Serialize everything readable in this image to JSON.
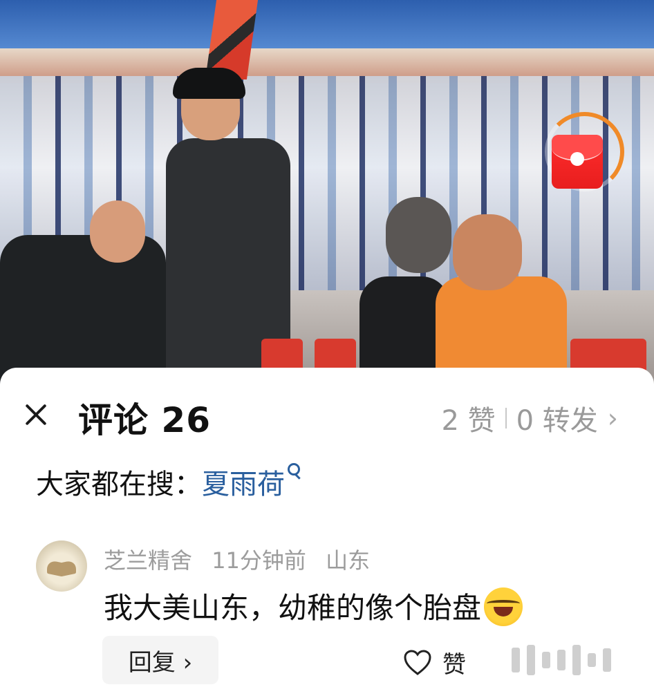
{
  "header": {
    "title": "评论 26",
    "likes": "2 赞",
    "shares": "0 转发",
    "chevron": "›"
  },
  "search": {
    "label": "大家都在搜：",
    "term": "夏雨荷"
  },
  "comments": [
    {
      "author": "芝兰精舍",
      "time": "11分钟前",
      "location": "山东",
      "text": "我大美山东，幼稚的像个胎盘",
      "emoji_icon": "laughing-crying-emoji",
      "reply_label": "回复 ›",
      "like_label": "赞"
    }
  ],
  "icons": {
    "close": "close-icon",
    "search": "search-icon",
    "red_packet": "red-packet-icon",
    "heart": "heart-icon"
  },
  "colors": {
    "link": "#2a5f9e",
    "muted": "#9a9a9a",
    "accent_ring": "#f08a28",
    "red_packet": "#e81e1e"
  }
}
